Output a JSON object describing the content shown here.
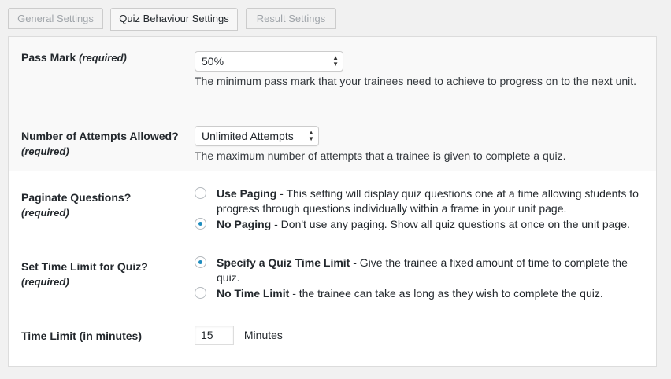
{
  "tabs": [
    {
      "label": "General Settings",
      "active": false
    },
    {
      "label": "Quiz Behaviour Settings",
      "active": true
    },
    {
      "label": "Result Settings",
      "active": false
    }
  ],
  "pass_mark": {
    "label": "Pass Mark",
    "required": "(required)",
    "value": "50%",
    "description": "The minimum pass mark that your trainees need to achieve to progress on to the next unit."
  },
  "attempts": {
    "label": "Number of Attempts Allowed?",
    "required": "(required)",
    "value": "Unlimited Attempts",
    "description": "The maximum number of attempts that a trainee is given to complete a quiz."
  },
  "paginate": {
    "label": "Paginate Questions?",
    "required": "(required)",
    "options": [
      {
        "title": "Use Paging",
        "text": " - This setting will display quiz questions one at a time allowing students to progress through questions individually within a frame in your unit page.",
        "checked": false
      },
      {
        "title": "No Paging",
        "text": " - Don't use any paging. Show all quiz questions at once on the unit page.",
        "checked": true
      }
    ]
  },
  "time_limit_setting": {
    "label": "Set Time Limit for Quiz?",
    "required": "(required)",
    "options": [
      {
        "title": "Specify a Quiz Time Limit",
        "text": " - Give the trainee a fixed amount of time to complete the quiz.",
        "checked": true
      },
      {
        "title": "No Time Limit",
        "text": " - the trainee can take as long as they wish to complete the quiz.",
        "checked": false
      }
    ]
  },
  "time_limit": {
    "label": "Time Limit (in minutes)",
    "value": "15",
    "unit": "Minutes"
  },
  "colors": {
    "radio_checked": "#1e8cbe",
    "row_shade": "#f9f9f9",
    "page_background": "#f1f1f1"
  }
}
